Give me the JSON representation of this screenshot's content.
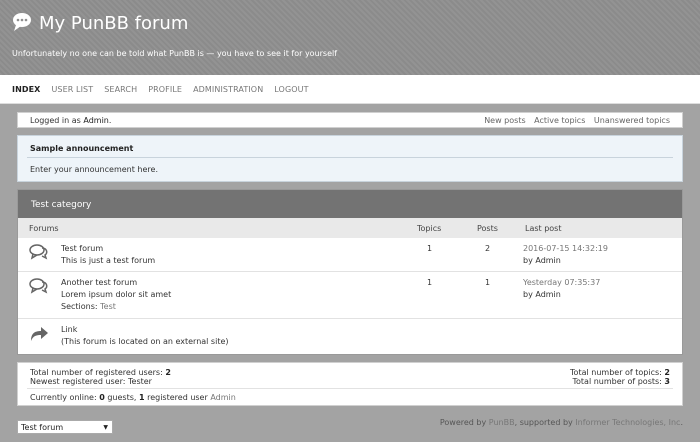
{
  "header": {
    "title": "My PunBB forum",
    "description": "Unfortunately no one can be told what PunBB is — you have to see it for yourself"
  },
  "nav": [
    "INDEX",
    "USER LIST",
    "SEARCH",
    "PROFILE",
    "ADMINISTRATION",
    "LOGOUT"
  ],
  "status": {
    "logged_prefix": "Logged in as",
    "user": "Admin",
    "suffix": ".",
    "links": [
      "New posts",
      "Active topics",
      "Unanswered topics"
    ]
  },
  "announcement": {
    "title": "Sample announcement",
    "body": "Enter your announcement here."
  },
  "category": {
    "title": "Test category",
    "columns": [
      "Forums",
      "Topics",
      "Posts",
      "Last post"
    ],
    "forums": [
      {
        "title": "Test forum",
        "desc": "This is just a test forum",
        "topics": "1",
        "posts": "2",
        "last_date": "2016-07-15 14:32:19",
        "last_by": "by Admin"
      },
      {
        "title": "Another test forum",
        "desc": "Lorem ipsum dolor sit amet",
        "sections_label": "Sections:",
        "sections_value": "Test",
        "topics": "1",
        "posts": "1",
        "last_date": "Yesterday 07:35:37",
        "last_by": "by Admin"
      },
      {
        "title": "Link",
        "desc": "(This forum is located on an external site)"
      }
    ]
  },
  "stats": {
    "users_label": "Total number of registered users:",
    "users_value": "2",
    "newest_label": "Newest registered user:",
    "newest_value": "Tester",
    "topics_label": "Total number of topics:",
    "topics_value": "2",
    "posts_label": "Total number of posts:",
    "posts_value": "3",
    "online_label": "Currently online:",
    "online_guests": "0",
    "online_guests_label": "guests,",
    "online_registered": "1",
    "online_registered_label": "registered user",
    "online_user": "Admin"
  },
  "footer": {
    "jump_selected": "Test forum",
    "powered_prefix": "Powered by",
    "powered_name": "PunBB",
    "supported_prefix": ", supported by",
    "supported_name": "Informer Technologies, Inc",
    "supported_suffix": "."
  },
  "icons": {
    "logo": "chat-bubbles-icon",
    "forum": "chat-bubbles-icon",
    "link": "redirect-arrow-icon"
  }
}
